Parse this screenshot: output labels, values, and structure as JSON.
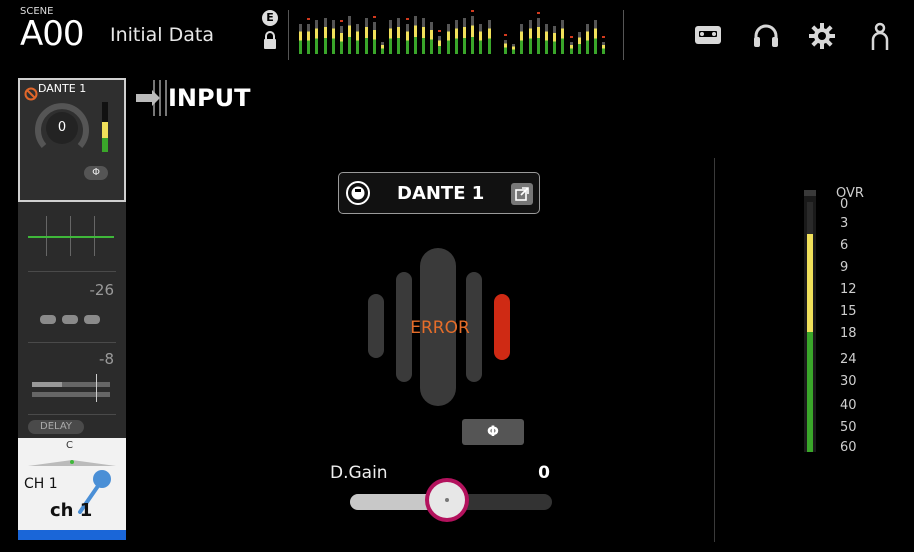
{
  "scene": {
    "label": "SCENE",
    "number": "A00",
    "name": "Initial Data"
  },
  "header": {
    "lock_badge": "E",
    "icons": [
      "recorder-icon",
      "headphones-icon",
      "gear-icon",
      "user-icon"
    ]
  },
  "strip": {
    "port": "DANTE 1",
    "gain": "0",
    "phase_label": "Φ",
    "threshold": "-26",
    "ratio": "-8",
    "delay_label": "DELAY",
    "pan_label": "C",
    "channel_number": "CH 1",
    "channel_name": "ch 1"
  },
  "page": {
    "title": "INPUT"
  },
  "input": {
    "port_button": "DANTE 1",
    "status": "ERROR",
    "phase_label": "Φ",
    "dgain_label": "D.Gain",
    "dgain_value": "0",
    "dgain_slider_fraction": 0.48
  },
  "meter": {
    "scale": [
      "OVR",
      "0",
      "3",
      "6",
      "9",
      "12",
      "15",
      "18",
      "24",
      "30",
      "40",
      "50",
      "60"
    ],
    "colors": {
      "green": "#3aa62a",
      "yellow": "#f0e05a",
      "red": "#d23a1e"
    }
  }
}
